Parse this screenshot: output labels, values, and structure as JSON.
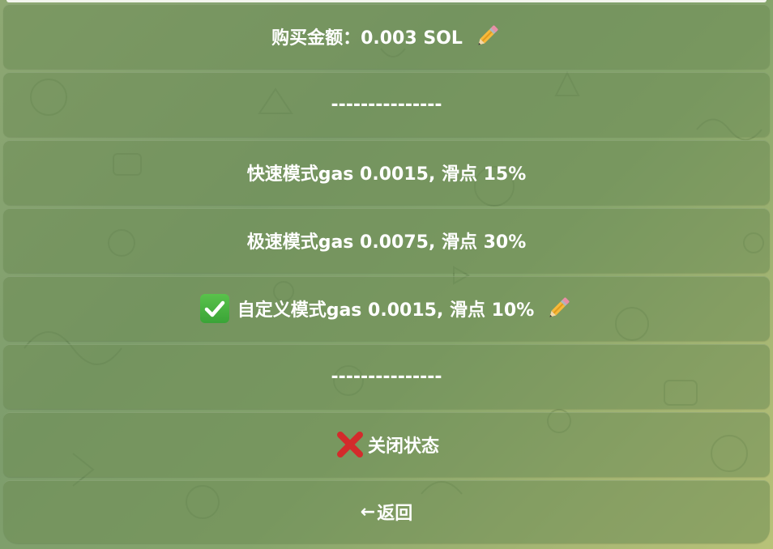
{
  "keyboard": {
    "buy_amount": "购买金额：0.003 SOL",
    "divider_1": "---------------",
    "fast_mode": "快速模式gas 0.0015, 滑点 15%",
    "turbo_mode": "极速模式gas 0.0075, 滑点 30%",
    "custom_mode": "自定义模式gas 0.0015, 滑点 10%",
    "divider_2": "---------------",
    "close_status": "关闭状态",
    "back_arrow": "←",
    "back": "返回"
  },
  "icons": {
    "buy_amount_icon": "pencil-icon",
    "custom_mode_prefix_icon": "check-mark-icon",
    "custom_mode_suffix_icon": "pencil-icon",
    "close_status_icon": "cross-mark-icon"
  },
  "colors": {
    "background_start": "#8ea873",
    "background_end": "#b8c278",
    "button_text": "#ffffff",
    "check_green": "#3aa437",
    "cross_red": "#d32b2b"
  }
}
